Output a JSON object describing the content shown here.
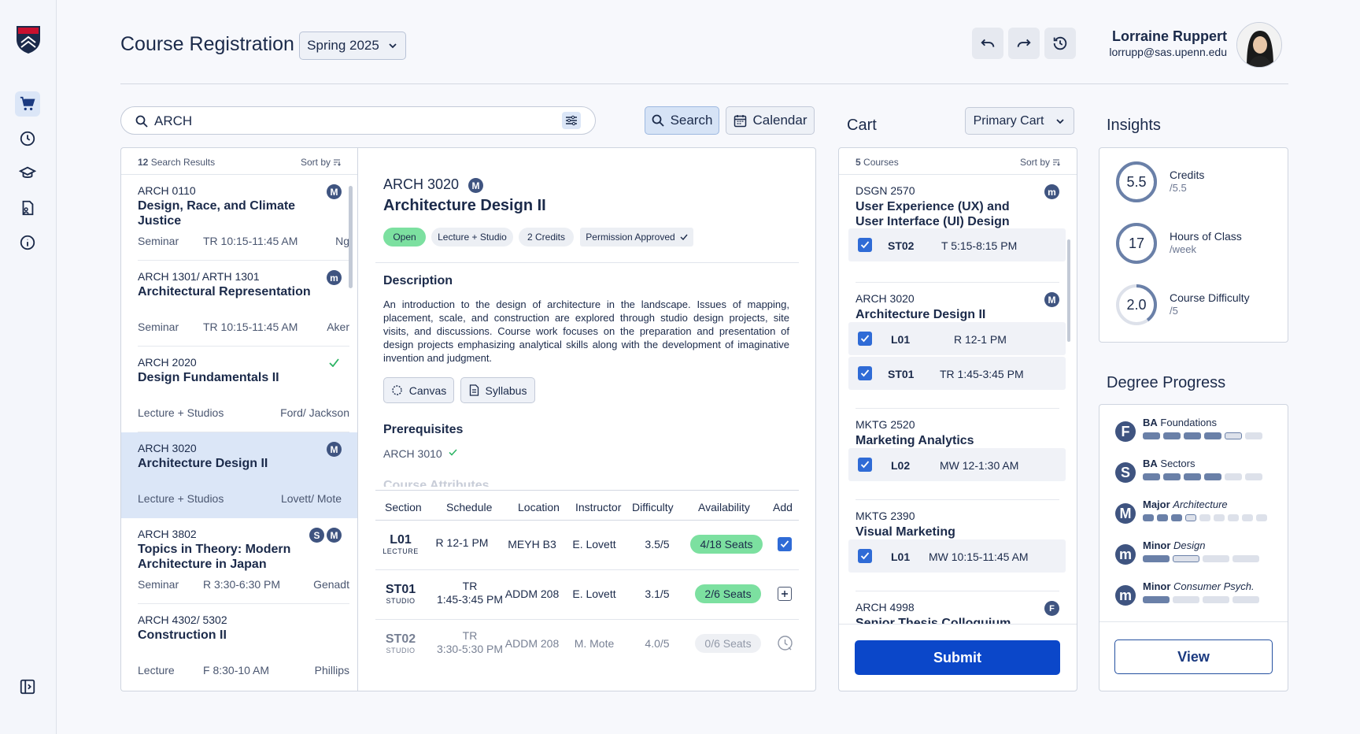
{
  "header": {
    "title": "Course Registration",
    "term": "Spring 2025",
    "user_name": "Lorraine Ruppert",
    "user_email": "lorrupp@sas.upenn.edu"
  },
  "search": {
    "value": "ARCH",
    "search_label": "Search",
    "calendar_label": "Calendar"
  },
  "results": {
    "count": "12",
    "count_label": "Search Results",
    "sort_label": "Sort by",
    "items": [
      {
        "code": "ARCH 0110",
        "title": "Design, Race, and Climate Justice",
        "type": "Seminar",
        "time": "TR 10:15-11:45 AM",
        "instructor": "Ng",
        "badges": [
          "M"
        ]
      },
      {
        "code": "ARCH 1301/ ARTH 1301",
        "title": "Architectural Representation",
        "type": "Seminar",
        "time": "TR 10:15-11:45 AM",
        "instructor": "Aker",
        "badges": [
          "m"
        ]
      },
      {
        "code": "ARCH 2020",
        "title": "Design Fundamentals II",
        "type": "Lecture + Studios",
        "time": "",
        "instructor": "Ford/ Jackson",
        "badges": [
          "check"
        ]
      },
      {
        "code": "ARCH 3020",
        "title": "Architecture Design II",
        "type": "Lecture + Studios",
        "time": "",
        "instructor": "Lovett/ Mote",
        "badges": [
          "M"
        ]
      },
      {
        "code": "ARCH 3802",
        "title": "Topics in Theory: Modern Architecture in Japan",
        "type": "Seminar",
        "time": "R 3:30-6:30 PM",
        "instructor": "Genadt",
        "badges": [
          "S",
          "M"
        ]
      },
      {
        "code": "ARCH 4302/ 5302",
        "title": "Construction II",
        "type": "Lecture",
        "time": "F 8:30-10 AM",
        "instructor": "Phillips",
        "badges": []
      }
    ]
  },
  "detail": {
    "code": "ARCH 3020",
    "badge": "M",
    "title": "Architecture Design II",
    "tags": [
      "Open",
      "Lecture + Studio",
      "2 Credits",
      "Permission Approved"
    ],
    "description_heading": "Description",
    "description": "An introduction to the design of architecture in the landscape. Issues of mapping, placement, scale, and construction are explored through studio design projects, site visits, and discussions. Course work focuses on the preparation and presentation of design projects emphasizing analytical skills along with the development of imaginative invention and judgment.",
    "canvas_label": "Canvas",
    "syllabus_label": "Syllabus",
    "prereq_heading": "Prerequisites",
    "prereq": "ARCH 3010",
    "attributes_heading": "Course Attributes",
    "columns": [
      "Section",
      "Schedule",
      "Location",
      "Instructor",
      "Difficulty",
      "Availability",
      "Add"
    ],
    "sections": [
      {
        "code": "L01",
        "kind": "LECTURE",
        "schedule_1": "R 12-1 PM",
        "schedule_2": "",
        "location": "MEYH B3",
        "instructor": "E. Lovett",
        "difficulty": "3.5/5",
        "seats": "4/18 Seats",
        "status": "added"
      },
      {
        "code": "ST01",
        "kind": "STUDIO",
        "schedule_1": "TR",
        "schedule_2": "1:45-3:45 PM",
        "location": "ADDM 208",
        "instructor": "E. Lovett",
        "difficulty": "3.1/5",
        "seats": "2/6 Seats",
        "status": "add"
      },
      {
        "code": "ST02",
        "kind": "STUDIO",
        "schedule_1": "TR",
        "schedule_2": "3:30-5:30 PM",
        "location": "ADDM 208",
        "instructor": "M. Mote",
        "difficulty": "4.0/5",
        "seats": "0/6 Seats",
        "status": "waitlist"
      }
    ]
  },
  "cart": {
    "title": "Cart",
    "cart_select": "Primary Cart",
    "count": "5",
    "count_label": "Courses",
    "sort_label": "Sort by",
    "submit_label": "Submit",
    "courses": [
      {
        "code": "DSGN 2570",
        "title": "User Experience (UX) and User Interface (UI) Design",
        "badge": "m",
        "sections": [
          {
            "code": "ST02",
            "time": "T 5:15-8:15 PM"
          }
        ]
      },
      {
        "code": "ARCH 3020",
        "title": "Architecture Design II",
        "badge": "M",
        "sections": [
          {
            "code": "L01",
            "time": "R 12-1 PM"
          },
          {
            "code": "ST01",
            "time": "TR 1:45-3:45 PM"
          }
        ]
      },
      {
        "code": "MKTG 2520",
        "title": "Marketing Analytics",
        "badge": "",
        "sections": [
          {
            "code": "L02",
            "time": "MW 12-1:30 AM"
          }
        ]
      },
      {
        "code": "MKTG 2390",
        "title": "Visual Marketing",
        "badge": "",
        "sections": [
          {
            "code": "L01",
            "time": "MW 10:15-11:45 AM"
          }
        ]
      },
      {
        "code": "ARCH 4998",
        "title": "Senior Thesis Colloquium",
        "badge": "F",
        "sections": []
      }
    ]
  },
  "insights": {
    "title": "Insights",
    "items": [
      {
        "value": "5.5",
        "label": "Credits",
        "sub": "/5.5",
        "fraction": 1.0
      },
      {
        "value": "17",
        "label": "Hours of Class",
        "sub": "/week",
        "fraction": 1.0
      },
      {
        "value": "2.0",
        "label": "Course Difficulty",
        "sub": "/5",
        "fraction": 0.4
      }
    ]
  },
  "degree": {
    "title": "Degree Progress",
    "view_label": "View",
    "items": [
      {
        "badge": "F",
        "label_bold": "BA",
        "label_rest": "Foundations",
        "italic": false,
        "segments": [
          "f",
          "f",
          "f",
          "f",
          "o",
          "e"
        ]
      },
      {
        "badge": "S",
        "label_bold": "BA",
        "label_rest": "Sectors",
        "italic": false,
        "segments": [
          "f",
          "f",
          "f",
          "f",
          "e",
          "e"
        ]
      },
      {
        "badge": "M",
        "label_bold": "Major",
        "label_rest": "Architecture",
        "italic": true,
        "segments": [
          "f",
          "f",
          "f",
          "o",
          "e",
          "e",
          "e",
          "e",
          "e"
        ]
      },
      {
        "badge": "m",
        "label_bold": "Minor",
        "label_rest": "Design",
        "italic": true,
        "segments": [
          "f",
          "o",
          "e",
          "e"
        ]
      },
      {
        "badge": "m",
        "label_bold": "Minor",
        "label_rest": "Consumer Psych.",
        "italic": true,
        "segments": [
          "f",
          "e",
          "e",
          "e"
        ]
      }
    ]
  },
  "colors": {
    "accent": "#0b47c9",
    "badge": "#3f5480",
    "open": "#7ce0a0",
    "selected": "#dbe6f7"
  }
}
